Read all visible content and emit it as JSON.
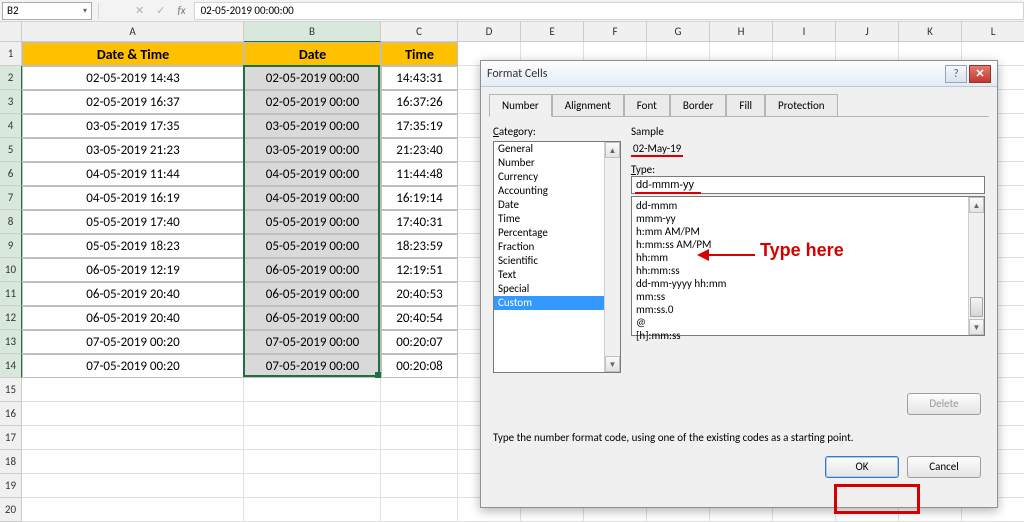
{
  "namebox": "B2",
  "formula_bar": "02-05-2019  00:00:00",
  "columns": [
    "A",
    "B",
    "C",
    "D",
    "E",
    "F",
    "G",
    "H",
    "I",
    "J",
    "K",
    "L"
  ],
  "headers": {
    "a": "Date & Time",
    "b": "Date",
    "c": "Time"
  },
  "rows": [
    {
      "n": 1
    },
    {
      "n": 2,
      "a": "02-05-2019 14:43",
      "b": "02-05-2019 00:00",
      "c": "14:43:31"
    },
    {
      "n": 3,
      "a": "02-05-2019 16:37",
      "b": "02-05-2019 00:00",
      "c": "16:37:26"
    },
    {
      "n": 4,
      "a": "03-05-2019 17:35",
      "b": "03-05-2019 00:00",
      "c": "17:35:19"
    },
    {
      "n": 5,
      "a": "03-05-2019 21:23",
      "b": "03-05-2019 00:00",
      "c": "21:23:40"
    },
    {
      "n": 6,
      "a": "04-05-2019 11:44",
      "b": "04-05-2019 00:00",
      "c": "11:44:48"
    },
    {
      "n": 7,
      "a": "04-05-2019 16:19",
      "b": "04-05-2019 00:00",
      "c": "16:19:14"
    },
    {
      "n": 8,
      "a": "05-05-2019 17:40",
      "b": "05-05-2019 00:00",
      "c": "17:40:31"
    },
    {
      "n": 9,
      "a": "05-05-2019 18:23",
      "b": "05-05-2019 00:00",
      "c": "18:23:59"
    },
    {
      "n": 10,
      "a": "06-05-2019 12:19",
      "b": "06-05-2019 00:00",
      "c": "12:19:51"
    },
    {
      "n": 11,
      "a": "06-05-2019 20:40",
      "b": "06-05-2019 00:00",
      "c": "20:40:53"
    },
    {
      "n": 12,
      "a": "06-05-2019 20:40",
      "b": "06-05-2019 00:00",
      "c": "20:40:54"
    },
    {
      "n": 13,
      "a": "07-05-2019 00:20",
      "b": "07-05-2019 00:00",
      "c": "00:20:07"
    },
    {
      "n": 14,
      "a": "07-05-2019 00:20",
      "b": "07-05-2019 00:00",
      "c": "00:20:08"
    },
    {
      "n": 15
    },
    {
      "n": 16
    },
    {
      "n": 17
    },
    {
      "n": 18
    },
    {
      "n": 19
    },
    {
      "n": 20
    }
  ],
  "dialog": {
    "title": "Format Cells",
    "tabs": [
      "Number",
      "Alignment",
      "Font",
      "Border",
      "Fill",
      "Protection"
    ],
    "category_label": "Category:",
    "categories": [
      "General",
      "Number",
      "Currency",
      "Accounting",
      "Date",
      "Time",
      "Percentage",
      "Fraction",
      "Scientific",
      "Text",
      "Special",
      "Custom"
    ],
    "selected_category": "Custom",
    "sample_label": "Sample",
    "sample_value": "02-May-19",
    "type_label": "Type:",
    "type_value": "dd-mmm-yy",
    "type_options": [
      "dd-mmm",
      "mmm-yy",
      "h:mm AM/PM",
      "h:mm:ss AM/PM",
      "hh:mm",
      "hh:mm:ss",
      "dd-mm-yyyy hh:mm",
      "mm:ss",
      "mm:ss.0",
      "@",
      "[h]:mm:ss"
    ],
    "help_text": "Type the number format code, using one of the existing codes as a starting point.",
    "delete": "Delete",
    "ok": "OK",
    "cancel": "Cancel"
  },
  "annotation": "Type here"
}
